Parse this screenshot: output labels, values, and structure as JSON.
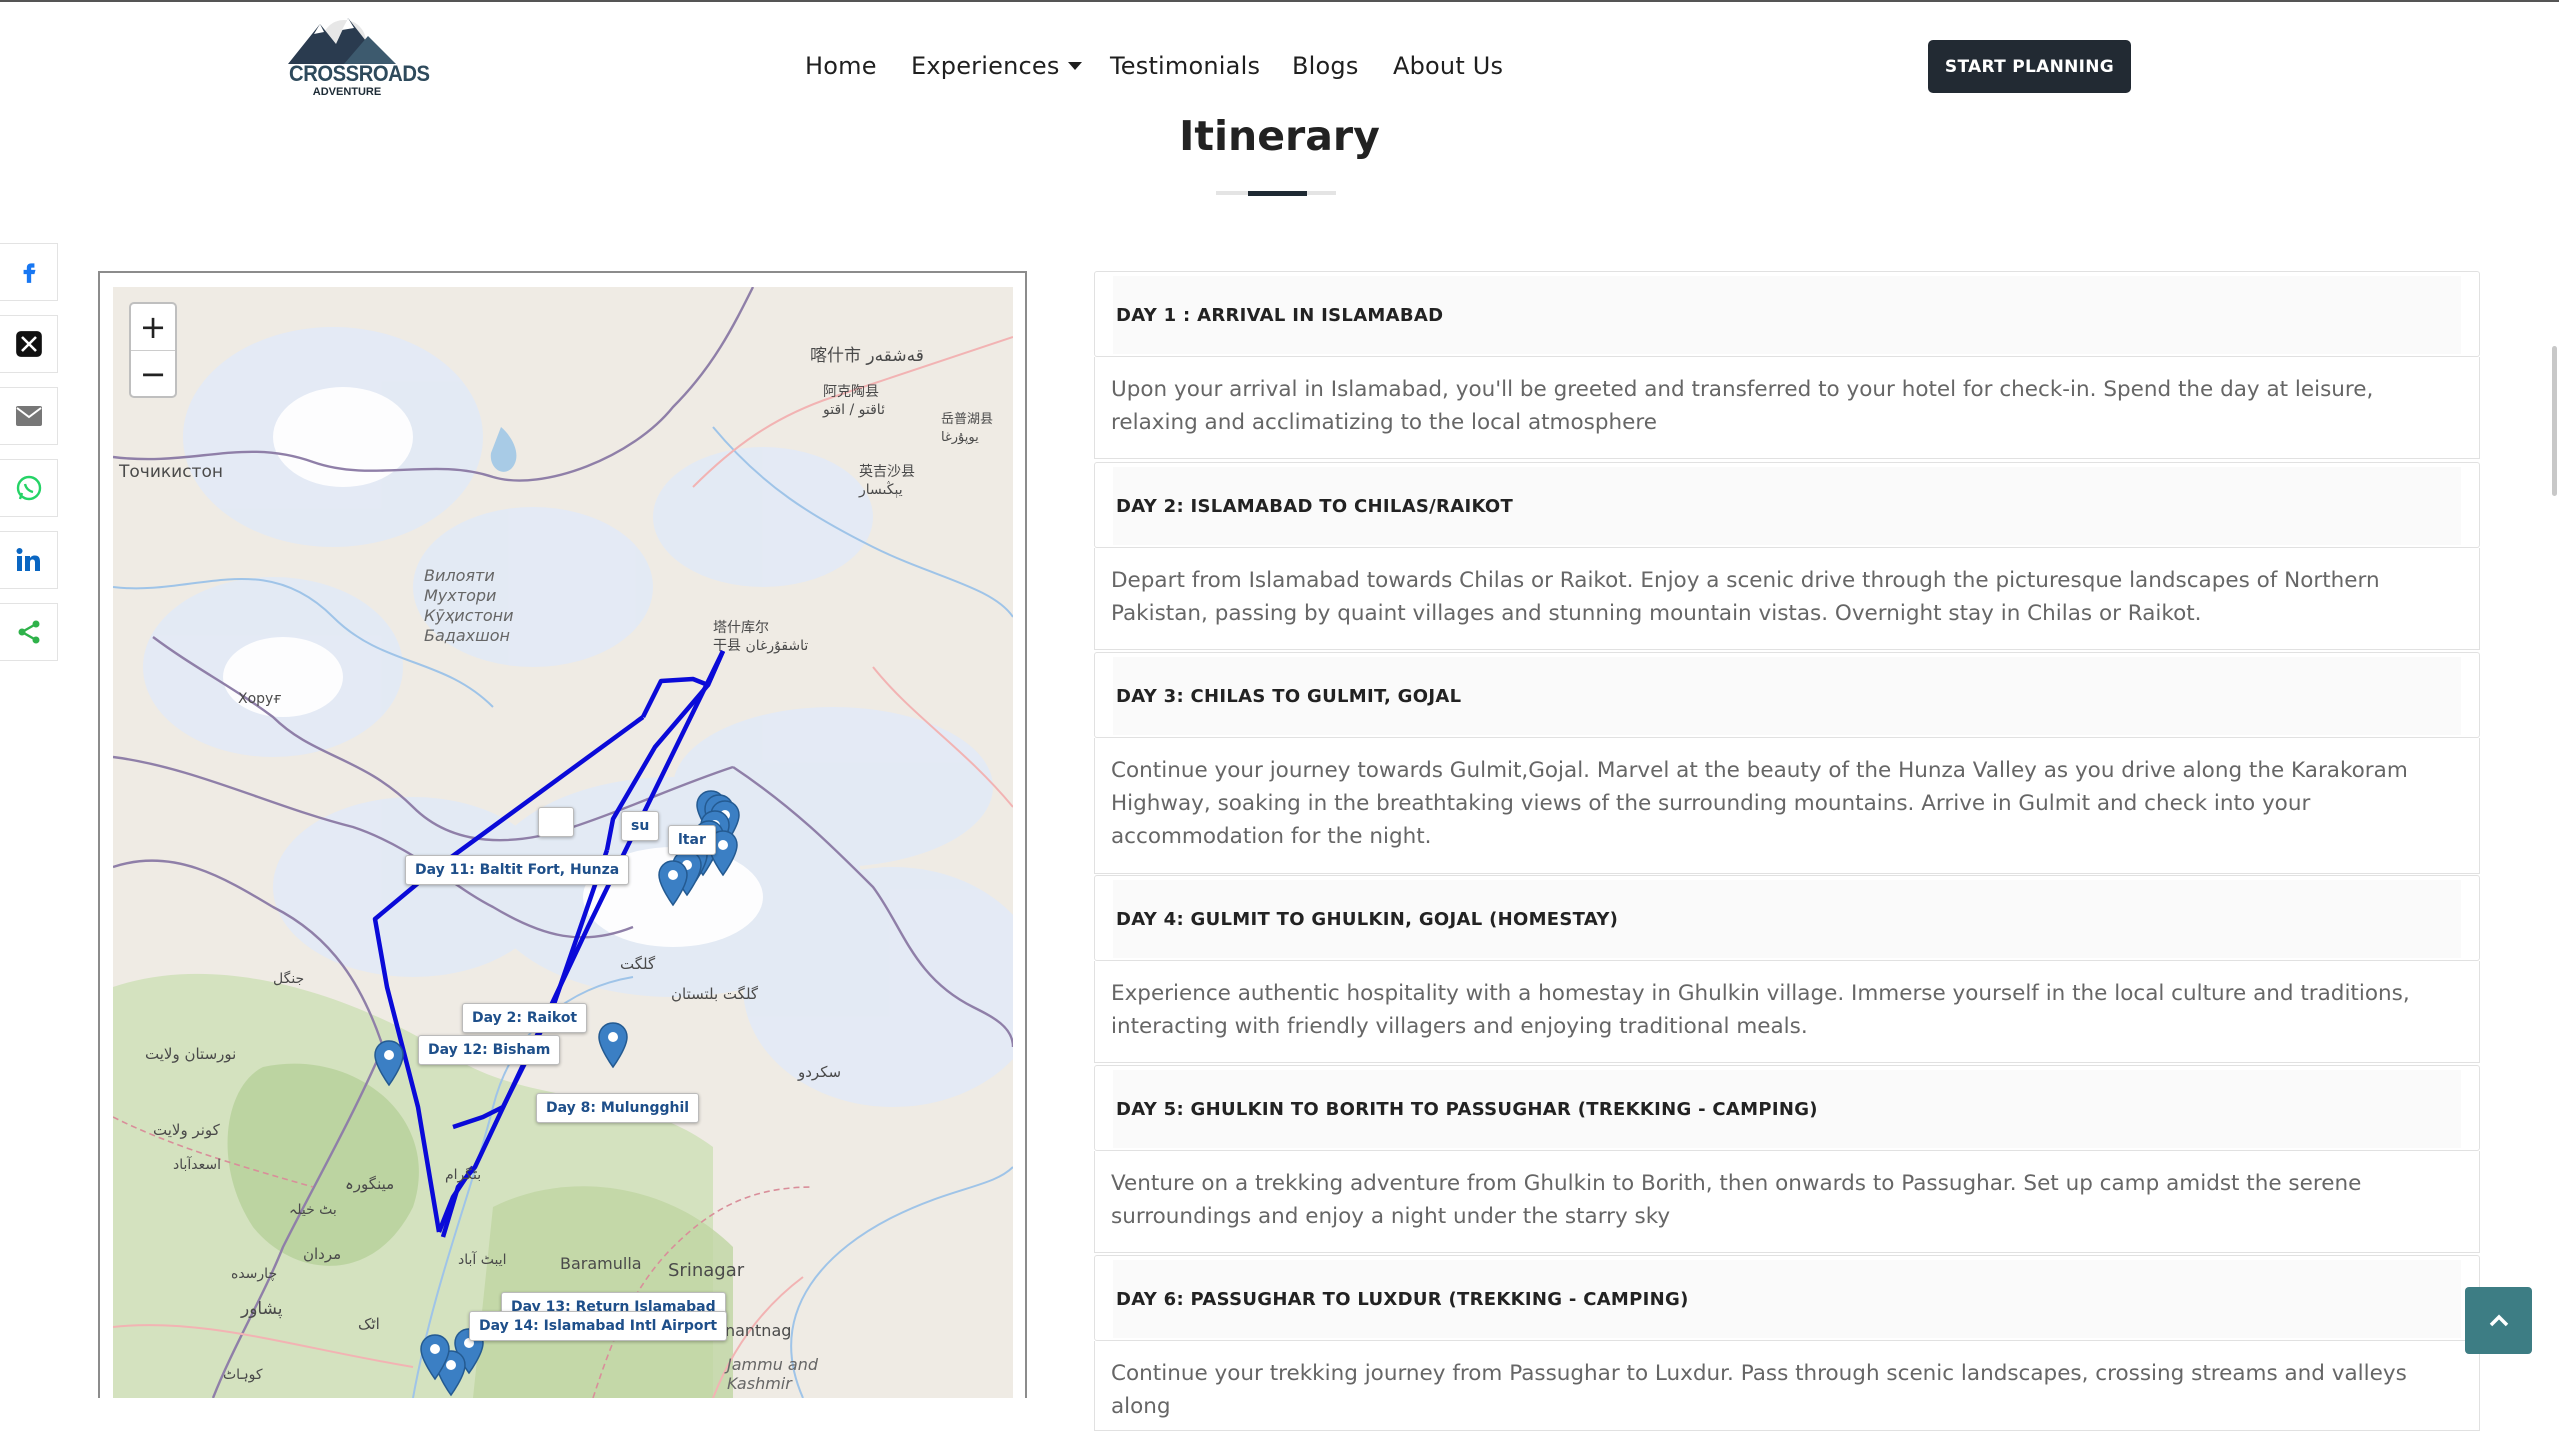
{
  "brand": {
    "logo_line1": "CROSSROADS",
    "logo_line2": "ADVENTURE"
  },
  "nav": {
    "home": "Home",
    "experiences": "Experiences",
    "testimonials": "Testimonials",
    "blogs": "Blogs",
    "about": "About Us"
  },
  "cta": "START PLANNING",
  "page_title": "Itinerary",
  "share_icons": [
    "facebook-icon",
    "x-icon",
    "email-icon",
    "whatsapp-icon",
    "linkedin-icon",
    "share-icon"
  ],
  "map": {
    "zoom_in": "+",
    "zoom_out": "−",
    "labels": {
      "tajik": "Точикистон",
      "gbao": "Вилояти\nМухтори\nКӯҳистони\nБадахшон",
      "khorugh": "Хоруғ",
      "kashgar": "喀什市 قەشقەر",
      "akto": "阿克陶县\nئاقتو / اقتو",
      "yengisar": "英吉沙县\nيېڭىسار",
      "yopurga": "岳普湖县\nيوپۇرغا",
      "tashkurgan": "塔什库尔\n干县 تاشقۇرغان",
      "gilgit": "گلگت",
      "gilgit_baltistan": "گلگت بلتستان",
      "skardu": "سکردو",
      "baramulla": "Baramulla",
      "srinagar": "Srinagar",
      "anantnag": "Anantnag",
      "jammu": "Jammu and\nKashmir",
      "peshawar": "پشاور",
      "mardan": "مردان",
      "nuristan": "نورستان ولايت",
      "kunar": "کونر ولایت",
      "asadabad": "اسعدآباد",
      "mingora": "مینگورہ",
      "butkhela": "بٹ خیلہ",
      "charsadda": "چارسده",
      "kohat": "کوہاٹ",
      "attock": "اٹک",
      "batgram": "بٹگرام",
      "abbottabad": "ایبٹ آباد",
      "jangal": "جنگل"
    },
    "markers": [
      "Day 8: Mulungghil",
      "Day 11: Baltit Fort, Hunza",
      "Day 2: Raikot",
      "Day 12: Bisham",
      "Day 13: Return Islamabad",
      "Day 14: Islamabad Intl Airport"
    ],
    "marker_partial_1": "su",
    "marker_partial_2": "ltar",
    "route_color": "#0a0ad8",
    "marker_color": "#3b7fc4"
  },
  "itinerary": [
    {
      "title": "DAY 1 : ARRIVAL IN ISLAMABAD",
      "body": "Upon your arrival in Islamabad, you'll be greeted and transferred to your hotel for check-in. Spend the day at leisure, relaxing and acclimatizing to the local atmosphere"
    },
    {
      "title": "DAY 2: ISLAMABAD TO CHILAS/RAIKOT",
      "body": "Depart from Islamabad towards Chilas or Raikot. Enjoy a scenic drive through the picturesque landscapes of Northern Pakistan, passing by quaint villages and stunning mountain vistas. Overnight stay in Chilas or Raikot."
    },
    {
      "title": "DAY 3: CHILAS TO GULMIT, GOJAL",
      "body": "Continue your journey towards Gulmit,Gojal. Marvel at the beauty of the Hunza Valley as you drive along the Karakoram Highway, soaking in the breathtaking views of the surrounding mountains. Arrive in Gulmit and check into your accommodation for the night."
    },
    {
      "title": "DAY 4: GULMIT TO GHULKIN, GOJAL (HOMESTAY)",
      "body": "Experience authentic hospitality with a homestay in Ghulkin village. Immerse yourself in the local culture and traditions, interacting with friendly villagers and enjoying traditional meals."
    },
    {
      "title": "DAY 5: GHULKIN TO BORITH TO PASSUGHAR (TREKKING - CAMPING)",
      "body": "Venture on a trekking adventure from Ghulkin to Borith, then onwards to Passughar. Set up camp amidst the serene surroundings and enjoy a night under the starry sky"
    },
    {
      "title": "DAY 6: PASSUGHAR TO LUXDUR (TREKKING - CAMPING)",
      "body": "Continue your trekking journey from Passughar to Luxdur. Pass through scenic landscapes, crossing streams and valleys along"
    }
  ]
}
